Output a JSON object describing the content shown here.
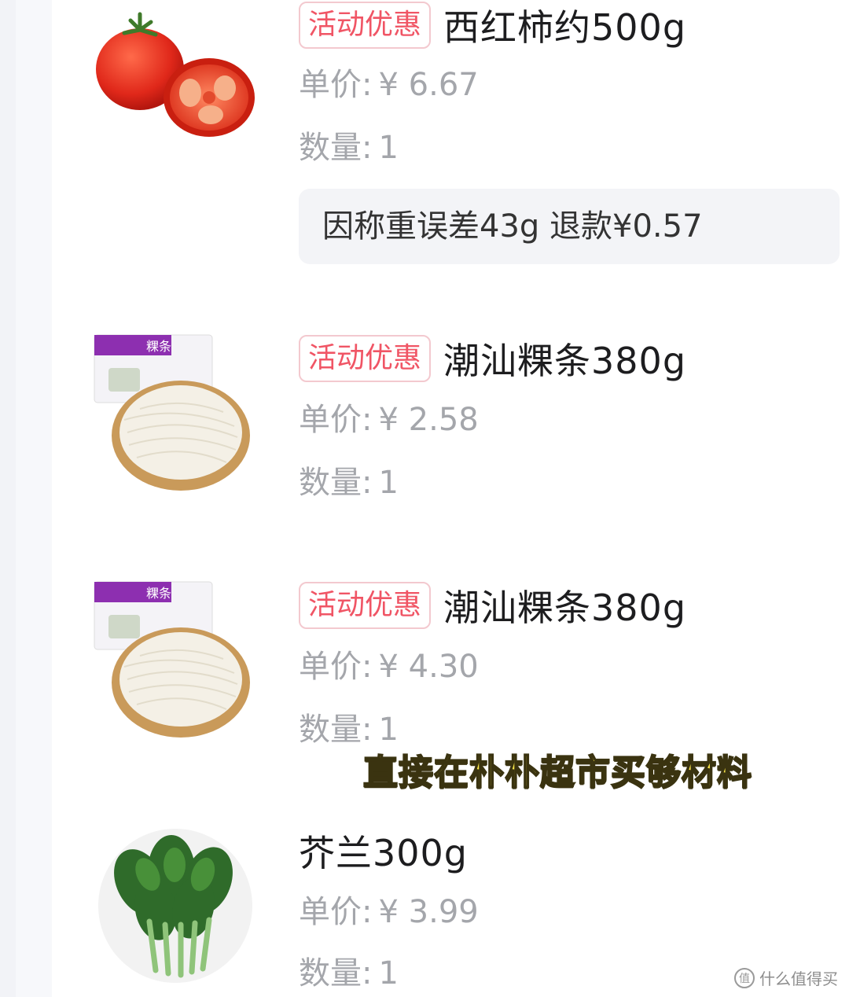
{
  "items": [
    {
      "badge": "活动优惠",
      "name": "西红柿约500g",
      "unit_price_label": "单价:",
      "unit_price": "¥ 6.67",
      "quantity_label": "数量:",
      "quantity": "1",
      "refund_note": "因称重误差43g 退款¥0.57",
      "image": "tomato-image"
    },
    {
      "badge": "活动优惠",
      "name": "潮汕粿条380g",
      "unit_price_label": "单价:",
      "unit_price": "¥ 2.58",
      "quantity_label": "数量:",
      "quantity": "1",
      "image": "rice-noodle-image"
    },
    {
      "badge": "活动优惠",
      "name": "潮汕粿条380g",
      "unit_price_label": "单价:",
      "unit_price": "¥ 4.30",
      "quantity_label": "数量:",
      "quantity": "1",
      "image": "rice-noodle-image"
    },
    {
      "name": "芥兰300g",
      "unit_price_label": "单价:",
      "unit_price": "¥ 3.99",
      "quantity_label": "数量:",
      "quantity": "1",
      "image": "kale-image"
    }
  ],
  "caption": "直接在朴朴超市买够材料",
  "watermark": "什么值得买",
  "package_label": "粿条",
  "colors": {
    "badge_text": "#f05565",
    "badge_border": "#f3c9cf",
    "caption_fill": "#ffe94a",
    "muted_text": "#a4a6ab"
  }
}
